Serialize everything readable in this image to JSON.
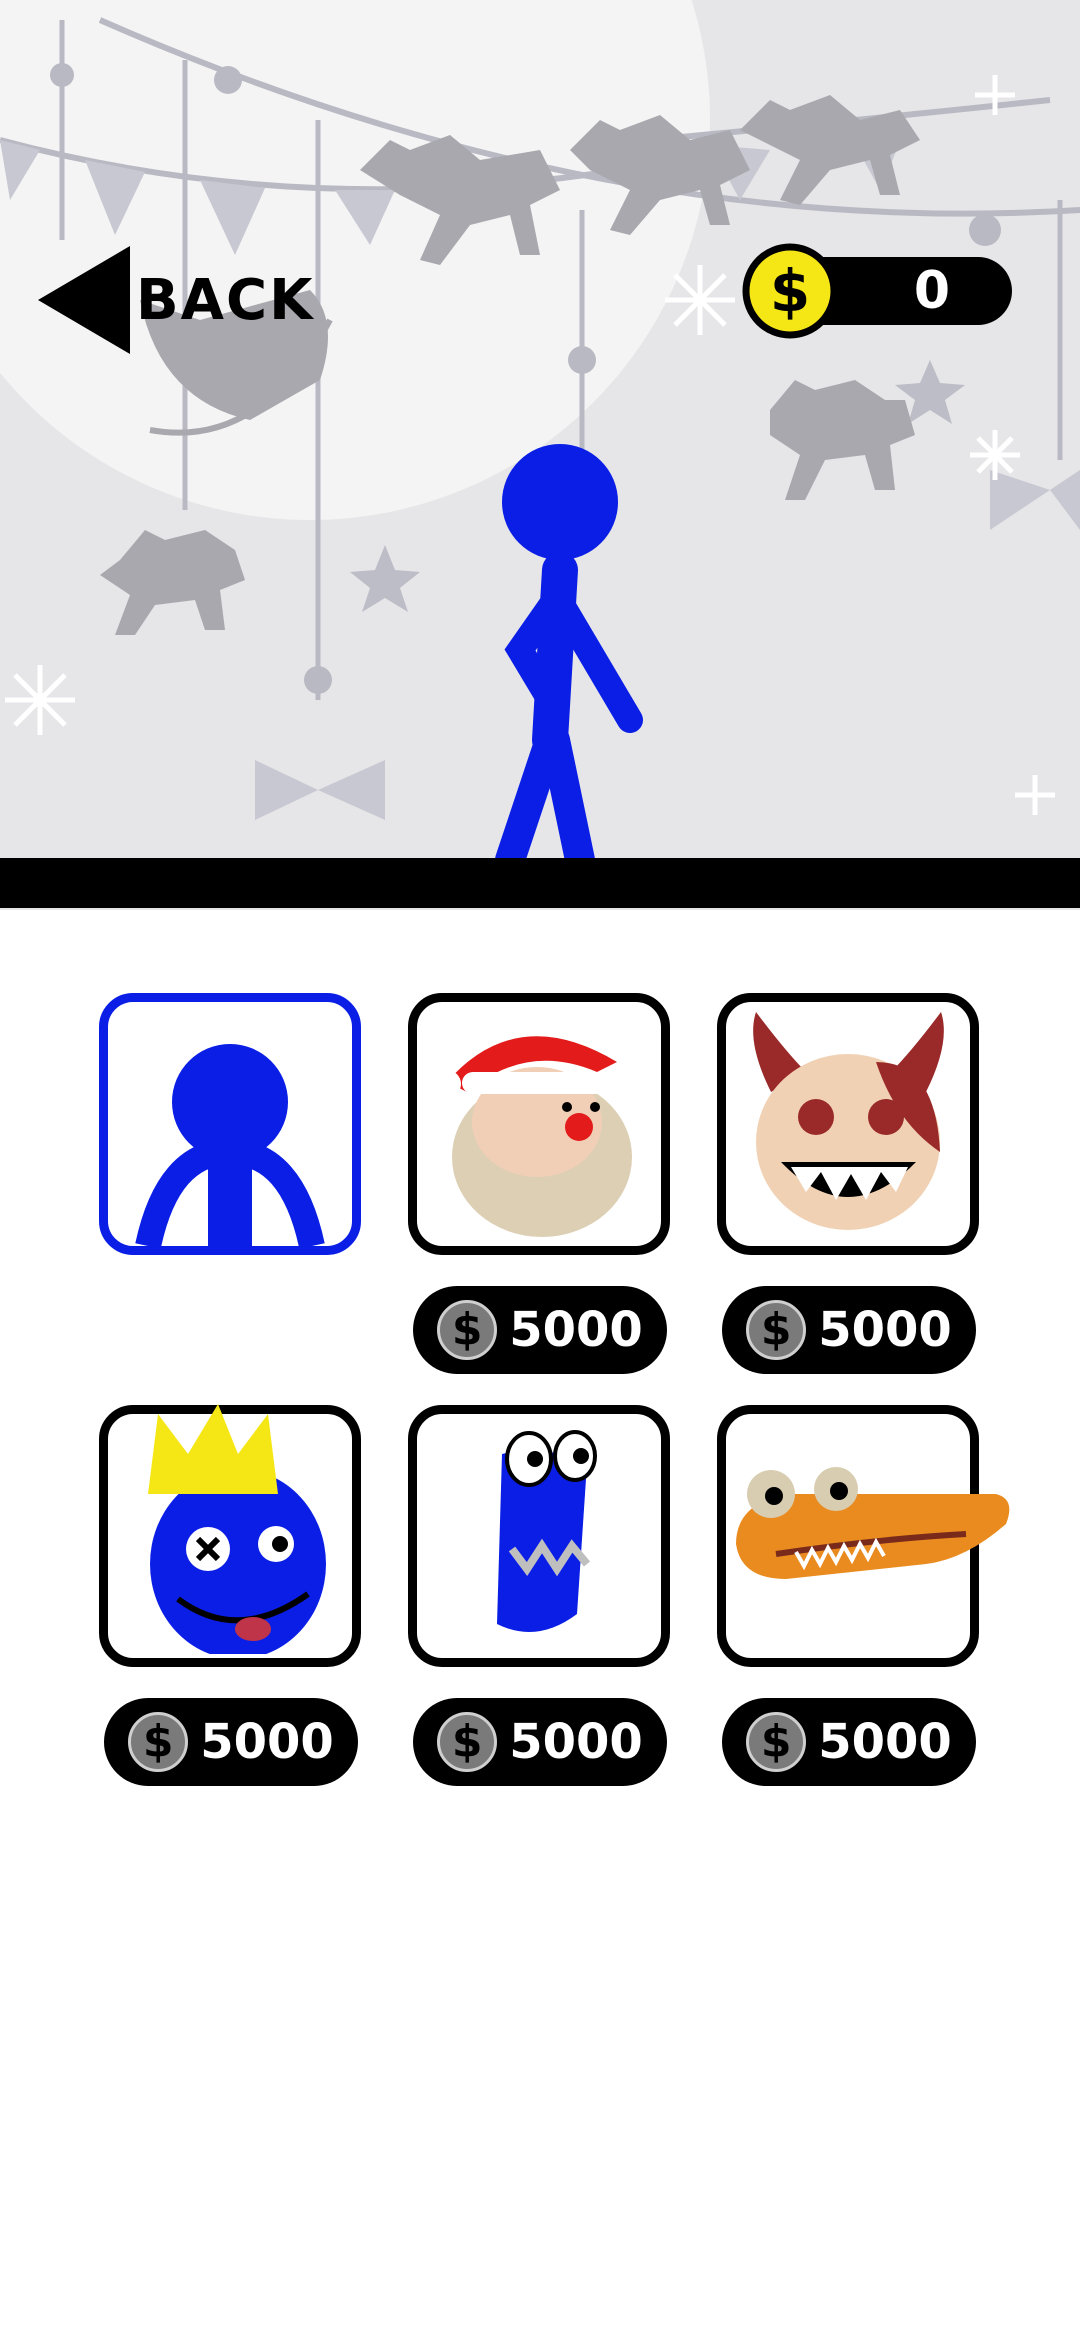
{
  "header": {
    "back_label": "BACK",
    "coin_symbol": "$",
    "coin_count": "0"
  },
  "skins": [
    {
      "name": "Blue Stickman",
      "selected": true,
      "price": ""
    },
    {
      "name": "Santa",
      "selected": false,
      "price": "5000",
      "price_symbol": "$"
    },
    {
      "name": "Demon",
      "selected": false,
      "price": "5000",
      "price_symbol": "$"
    },
    {
      "name": "Blue King",
      "selected": false,
      "price": "5000",
      "price_symbol": "$"
    },
    {
      "name": "Blue Worm",
      "selected": false,
      "price": "5000",
      "price_symbol": "$"
    },
    {
      "name": "Crocodile",
      "selected": false,
      "price": "5000",
      "price_symbol": "$"
    }
  ],
  "colors": {
    "stickman": "#0a1ee6",
    "coin": "#f5e616",
    "selected_border": "#0a1ee6"
  }
}
